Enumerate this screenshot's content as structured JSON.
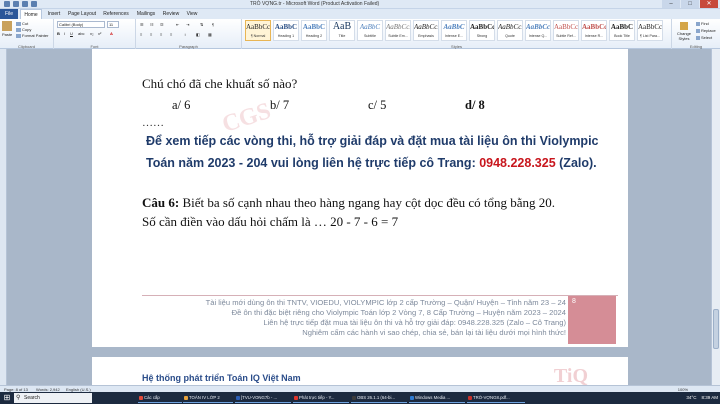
{
  "window": {
    "title": "TRÒ VỢNG.tr - Microsoft Word (Product Activation Failed)",
    "controls": [
      "–",
      "□",
      "✕"
    ]
  },
  "tabs": [
    "File",
    "Home",
    "Insert",
    "Page Layout",
    "References",
    "Mailings",
    "Review",
    "View"
  ],
  "active_tab": "Home",
  "ribbon": {
    "clipboard": {
      "paste": "Paste",
      "cut": "Cut",
      "copy": "Copy",
      "format_painter": "Format Painter",
      "label": "Clipboard"
    },
    "font": {
      "family": "Calibri (Body)",
      "size": "11",
      "label": "Font"
    },
    "paragraph": {
      "label": "Paragraph"
    },
    "styles": {
      "label": "Styles",
      "items": [
        {
          "preview": "AaBbCc",
          "name": "¶ Normal"
        },
        {
          "preview": "AaBbC",
          "name": "Heading 1"
        },
        {
          "preview": "AaBbC",
          "name": "Heading 2"
        },
        {
          "preview": "AaB",
          "name": "Title"
        },
        {
          "preview": "AaBbC",
          "name": "Subtitle"
        },
        {
          "preview": "AaBbCcD",
          "name": "Subtle Em..."
        },
        {
          "preview": "AaBbCcD",
          "name": "Emphasis"
        },
        {
          "preview": "AaBbC",
          "name": "Intense E..."
        },
        {
          "preview": "AaBbCcD",
          "name": "Strong"
        },
        {
          "preview": "AaBbCcD",
          "name": "Quote"
        },
        {
          "preview": "AaBbCcD",
          "name": "Intense Q..."
        },
        {
          "preview": "AaBbCcD",
          "name": "Subtle Ref..."
        },
        {
          "preview": "AaBbCc",
          "name": "Intense R..."
        },
        {
          "preview": "AaBbC",
          "name": "Book Title"
        },
        {
          "preview": "AaBbCc",
          "name": "¶ List Para..."
        }
      ],
      "change_styles": "Change Styles"
    },
    "editing": {
      "find": "Find",
      "replace": "Replace",
      "select": "Select",
      "label": "Editing"
    }
  },
  "document": {
    "question_line": "Chú chó đã che khuất số nào?",
    "options": [
      "a/ 6",
      "b/ 7",
      "c/ 5",
      "d/ 8"
    ],
    "ellipsis": "……",
    "promo_line1": "Để xem tiếp các vòng thi, hỗ trợ giải đáp và đặt mua tài liệu ôn thi Violympic",
    "promo_line2_prefix": "Toán năm 2023 - 204 vui lòng liên hệ trực tiếp cô Trang: ",
    "promo_phone": "0948.228.325",
    "promo_suffix": " (Zalo).",
    "q6_label": "Câu 6:",
    "q6_text": " Biết ba số cạnh nhau theo hàng ngang hay cột dọc đều có tổng bằng 20.",
    "q6_line2": "Số cần điền vào dấu hỏi chấm là … 20 - 7 - 6 = 7",
    "watermark": "CGS",
    "footer": [
      "Tài liệu mới dùng ôn thi TNTV, VIOEDU, VIOLYMPIC lớp 2 cấp Trường – Quận/ Huyện – Tỉnh năm 23 – 24",
      "Đề ôn thi đặc biệt riêng cho Violympic Toán lớp 2 Vòng 7, 8 Cấp Trường – Huyện năm 2023 – 2024",
      "Liên hệ trực tiếp đặt mua tài liệu ôn thi và hỗ trợ giải đáp: 0948.228.325 (Zalo – Cô Trang)",
      "Nghiêm cấm các hành vi sao chép, chia sẻ, bán lại tài liệu dưới mọi hình thức!"
    ],
    "footer_page_number": "8",
    "page2_title": "Hệ thống phát triển Toán IQ Việt Nam",
    "page2_logo": "TiQ"
  },
  "status": {
    "page": "Page: 8 of 13",
    "words": "Words: 2,942",
    "language": "English (U.S.)",
    "zoom": "100%"
  },
  "taskbar": {
    "search_placeholder": "Search",
    "items": [
      {
        "label": "Các cấp",
        "color": "#e24b3b"
      },
      {
        "label": "TOÁN IV LỚP 2",
        "color": "#e8a33c"
      },
      {
        "label": "[TVU-VONG7b - ...",
        "color": "#2a5eb5"
      },
      {
        "label": "Phát trực tiếp - Y...",
        "color": "#e0352b"
      },
      {
        "label": "OBS 26.1.1 (64-bi...",
        "color": "#3c3c3c"
      },
      {
        "label": "Windows Media ...",
        "color": "#2e7ad1"
      },
      {
        "label": "TRÒ-VỢNG8.pdf...",
        "color": "#c8312a"
      }
    ],
    "tray": {
      "weather": "34°C",
      "time": "8:39 AM"
    }
  }
}
